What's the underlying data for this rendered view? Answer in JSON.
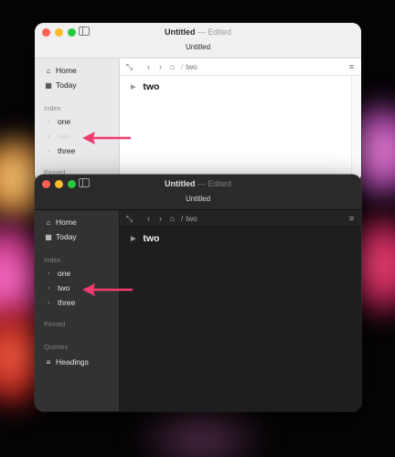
{
  "colors": {
    "accent_arrow": "#f03c6e",
    "traffic_red": "#ff5f57",
    "traffic_yellow": "#febc2e",
    "traffic_green": "#28c840"
  },
  "light_window": {
    "title": "Untitled",
    "separator": "—",
    "edited": "Edited",
    "subtitle": "Untitled",
    "sidebar": {
      "home": "Home",
      "today": "Today",
      "index_header": "Index",
      "items": [
        "one",
        "two",
        "three"
      ],
      "pinned_header": "Pinned"
    },
    "breadcrumb": "two",
    "heading": "two"
  },
  "dark_window": {
    "title": "Untitled",
    "separator": "—",
    "edited": "Edited",
    "subtitle": "Untitled",
    "sidebar": {
      "home": "Home",
      "today": "Today",
      "index_header": "Index",
      "items": [
        "one",
        "two",
        "three"
      ],
      "pinned_header": "Pinned",
      "queries_header": "Queries",
      "headings": "Headings"
    },
    "breadcrumb": "two",
    "heading": "two"
  },
  "icons": {
    "home": "house-icon",
    "today": "calendar-icon",
    "headings": "list-icon",
    "expand": "expand-arrows-icon",
    "back": "chevron-left-icon",
    "forward": "chevron-right-icon",
    "root": "house-icon",
    "menu": "hamburger-icon"
  }
}
